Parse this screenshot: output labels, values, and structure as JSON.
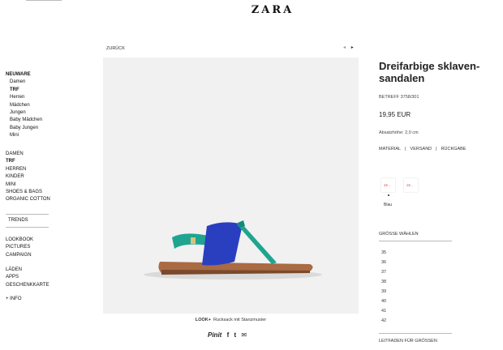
{
  "brand": "ZARA",
  "nav": {
    "top": {
      "label": "NEUWARE",
      "items": [
        "Damen",
        "TRF",
        "Herren",
        "Mädchen",
        "Jungen",
        "Baby Mädchen",
        "Baby Jungen",
        "Mini"
      ]
    },
    "main": [
      "DAMEN",
      "TRF",
      "HERREN",
      "KINDER",
      "MINI",
      "SHOES & BAGS",
      "ORGANIC COTTON"
    ],
    "trends": "TRENDS",
    "extra": [
      "LOOKBOOK",
      "PICTURES",
      "CAMPAIGN"
    ],
    "stores": [
      "LÄDEN",
      "APPS",
      "GESCHENKKARTE"
    ],
    "info": "+ INFO"
  },
  "product": {
    "back": "ZURÜCK",
    "arrow_prev": "◂",
    "arrow_next": "▸",
    "title": "Dreifarbige sklaven-sandalen",
    "ref": "BETREFF 3758/301",
    "price": "19,95 EUR",
    "height": "Absatzhöhe: 2,0 cm",
    "links": [
      "MATERIAL",
      "VERSAND",
      "RÜCKGABE"
    ],
    "link_sep": "|",
    "color_label": "Blau",
    "swatch_text": "ZE...",
    "sizes_header": "GRÖSSE WÄHLEN",
    "sizes": [
      "35",
      "36",
      "37",
      "38",
      "39",
      "40",
      "41",
      "42"
    ],
    "size_guide": "LEITFADEN FÜR GRÖSSEN",
    "caption_bold": "LOOK+",
    "caption": "Rucksack mit Stanzmuster",
    "social": [
      "Pinit",
      "f",
      "t",
      "✉"
    ]
  },
  "colors": {
    "strap_blue": "#2a3fbf",
    "strap_teal": "#1fa58f",
    "sole": "#a96a44",
    "background": "#f1f1f1"
  }
}
